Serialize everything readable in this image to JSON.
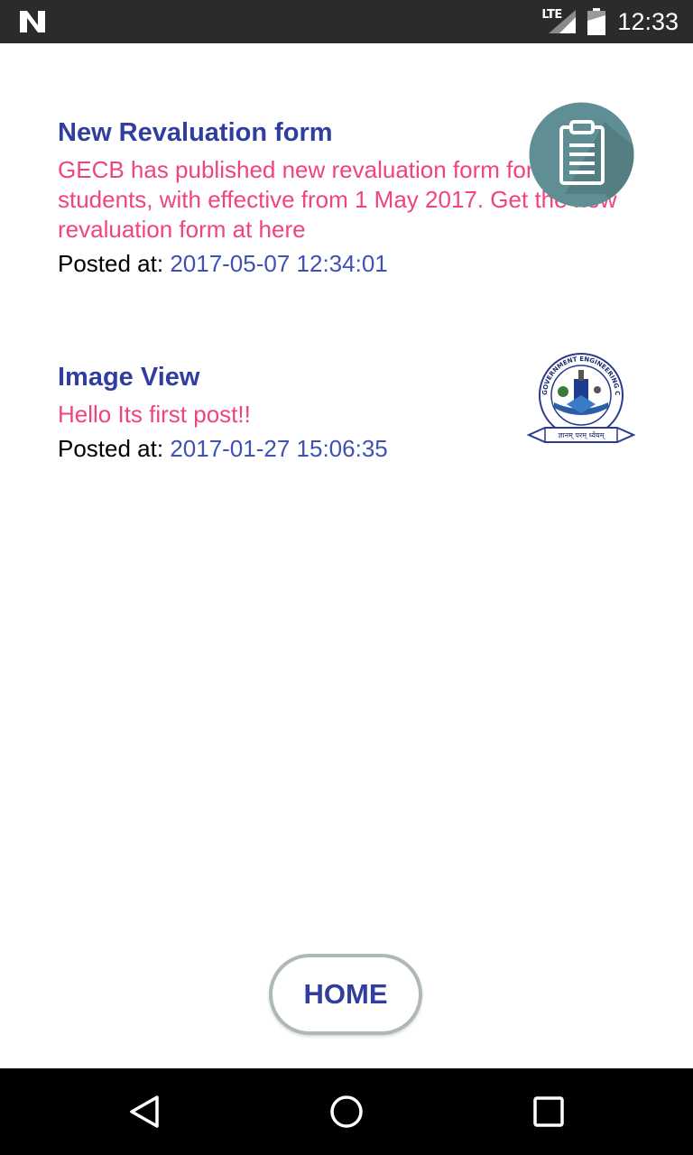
{
  "status_bar": {
    "network_label": "LTE",
    "time": "12:33"
  },
  "posts": [
    {
      "title": "New Revaluation form",
      "body": "GECB has published new revaluation form for students, with effective from 1 May 2017. Get the new revaluation form at here",
      "posted_label": "Posted at: ",
      "timestamp": "2017-05-07 12:34:01",
      "icon": "clipboard-icon"
    },
    {
      "title": "Image View",
      "body": "Hello Its first post!!",
      "posted_label": "Posted at: ",
      "timestamp": "2017-01-27 15:06:35",
      "icon": "college-emblem",
      "emblem_text": "GOVERNMENT ENGINEERING COLLEGE BIKANER",
      "emblem_motto": "ज्ञानम् परम् ध्येयम्"
    }
  ],
  "home_button": {
    "label": "HOME"
  },
  "colors": {
    "title": "#303f9f",
    "body": "#f0447b",
    "timestamp": "#3f51b5",
    "clipboard_bg": "#5f8f94"
  }
}
